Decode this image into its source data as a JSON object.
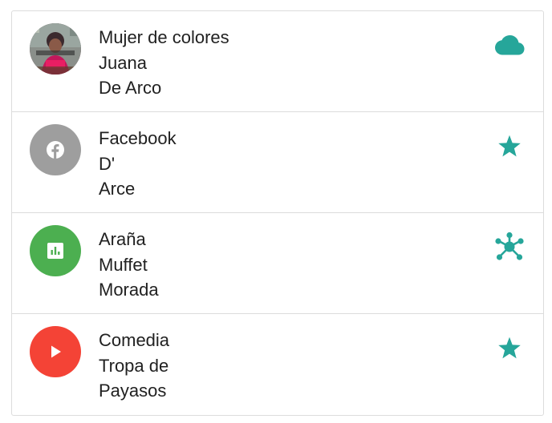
{
  "colors": {
    "accent": "#26a69a",
    "facebook_avatar": "#9e9e9e",
    "chart_avatar": "#4caf50",
    "play_avatar": "#f44336",
    "divider": "#dcdcdc"
  },
  "items": [
    {
      "avatar_icon": "photo-avatar",
      "lines": [
        "Mujer de colores",
        "Juana",
        "De Arco"
      ],
      "action_icon": "cloud-icon"
    },
    {
      "avatar_icon": "facebook-icon",
      "lines": [
        "Facebook",
        "D'",
        "Arce"
      ],
      "action_icon": "star-icon"
    },
    {
      "avatar_icon": "bar-chart-icon",
      "lines": [
        "Araña",
        "Muffet",
        "Morada"
      ],
      "action_icon": "bubble-chart-icon"
    },
    {
      "avatar_icon": "play-icon",
      "lines": [
        "Comedia",
        "Tropa de",
        "Payasos"
      ],
      "action_icon": "star-icon"
    }
  ]
}
